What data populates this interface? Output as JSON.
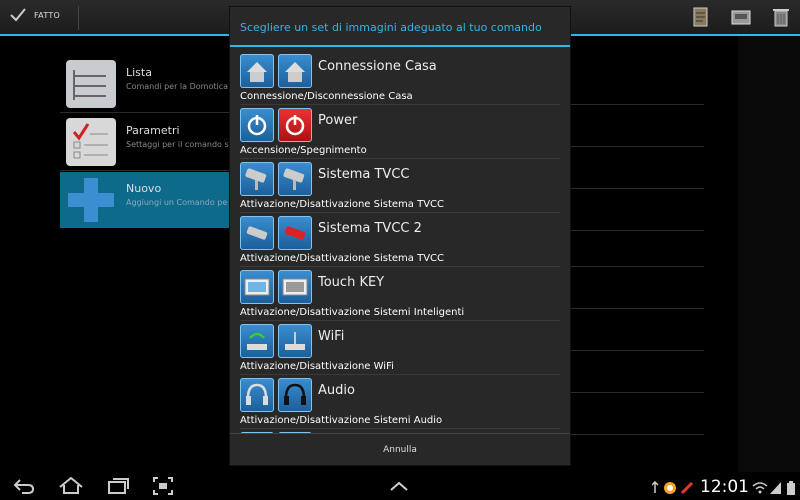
{
  "actionbar": {
    "done_label": "FATTO",
    "icons": [
      "edit-document-icon",
      "save-icon",
      "trash-icon"
    ]
  },
  "menu": [
    {
      "title": "Lista",
      "subtitle": "Comandi per la Domotica c"
    },
    {
      "title": "Parametri",
      "subtitle": "Settaggi per il comando selezionato"
    },
    {
      "title": "Nuovo",
      "subtitle": "Aggiungi un Comando pe"
    }
  ],
  "dialog": {
    "title": "Scegliere un set di immagini adeguato al tuo comando",
    "items": [
      {
        "name": "Connessione Casa",
        "description": "Connessione/Disconnessione Casa"
      },
      {
        "name": "Power",
        "description": "Accensione/Spegnimento"
      },
      {
        "name": "Sistema TVCC",
        "description": "Attivazione/Disattivazione Sistema TVCC"
      },
      {
        "name": "Sistema TVCC 2",
        "description": "Attivazione/Disattivazione Sistema TVCC"
      },
      {
        "name": "Touch KEY",
        "description": "Attivazione/Disattivazione Sistemi Inteligenti"
      },
      {
        "name": "WiFi",
        "description": "Attivazione/Disattivazione WiFi"
      },
      {
        "name": "Audio",
        "description": "Attivazione/Disattivazione Sistemi Audio"
      }
    ],
    "cancel_label": "Annulla"
  },
  "statusbar": {
    "time": "12:01"
  },
  "colors": {
    "accent": "#33b5e5",
    "selected_item": "#0e6a8a"
  }
}
